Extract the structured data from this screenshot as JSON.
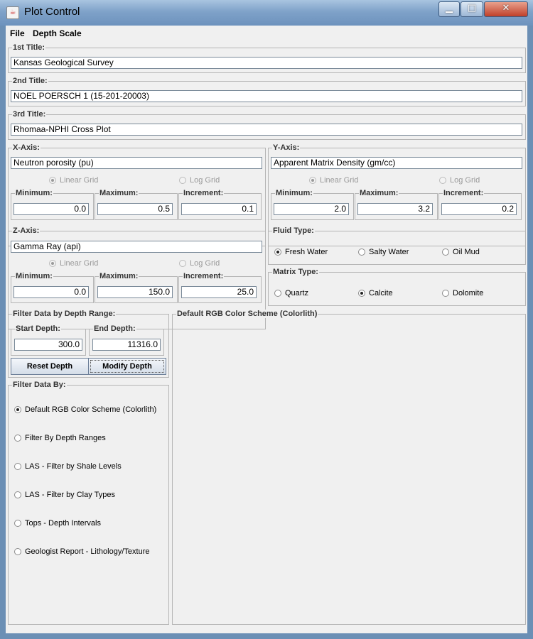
{
  "window": {
    "title": "Plot Control",
    "icon": "java-cup-icon",
    "minimize_glyph": "▁",
    "maximize_glyph": "□",
    "close_glyph": "✕"
  },
  "menu": [
    "File",
    "Depth Scale"
  ],
  "titles": [
    {
      "label": "1st Title:",
      "value": "Kansas Geological Survey"
    },
    {
      "label": "2nd Title:",
      "value": "NOEL POERSCH 1 (15-201-20003)"
    },
    {
      "label": "3rd Title:",
      "value": "Rhomaa-NPHI Cross Plot"
    }
  ],
  "x_axis": {
    "label": "X-Axis:",
    "name": "Neutron porosity (pu)",
    "linear": "Linear Grid",
    "log": "Log Grid",
    "selected": "Linear Grid",
    "min_label": "Minimum:",
    "min": "0.0",
    "max_label": "Maximum:",
    "max": "0.5",
    "inc_label": "Increment:",
    "inc": "0.1"
  },
  "y_axis": {
    "label": "Y-Axis:",
    "name": "Apparent Matrix Density (gm/cc)",
    "linear": "Linear Grid",
    "log": "Log Grid",
    "selected": "Linear Grid",
    "min_label": "Minimum:",
    "min": "2.0",
    "max_label": "Maximum:",
    "max": "3.2",
    "inc_label": "Increment:",
    "inc": "0.2"
  },
  "z_axis": {
    "label": "Z-Axis:",
    "name": "Gamma Ray (api)",
    "linear": "Linear Grid",
    "log": "Log Grid",
    "selected": "Linear Grid",
    "min_label": "Minimum:",
    "min": "0.0",
    "max_label": "Maximum:",
    "max": "150.0",
    "inc_label": "Increment:",
    "inc": "25.0"
  },
  "fluid": {
    "label": "Fluid Type:",
    "options": [
      "Fresh Water",
      "Salty Water",
      "Oil Mud"
    ],
    "selected": "Fresh Water"
  },
  "matrix": {
    "label": "Matrix Type:",
    "options": [
      "Quartz",
      "Calcite",
      "Dolomite"
    ],
    "selected": "Calcite"
  },
  "depth_filter": {
    "label": "Filter Data by Depth Range:",
    "start_label": "Start Depth:",
    "start": "300.0",
    "end_label": "End Depth:",
    "end": "11316.0",
    "reset": "Reset Depth",
    "modify": "Modify Depth"
  },
  "filter_by": {
    "label": "Filter Data By:",
    "options": [
      "Default RGB Color Scheme (Colorlith)",
      "Filter By Depth Ranges",
      "LAS - Filter by Shale Levels",
      "LAS - Filter by Clay Types",
      "Tops - Depth Intervals",
      "Geologist Report - Lithology/Texture"
    ],
    "selected": "Default RGB Color Scheme (Colorlith)"
  },
  "scheme_panel": {
    "label": "Default RGB Color Scheme (Colorlith)"
  }
}
